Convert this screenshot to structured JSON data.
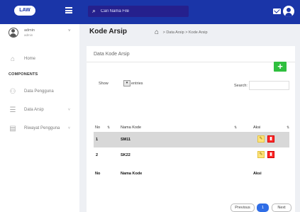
{
  "app": {
    "logo_text": "LAW"
  },
  "topbar": {
    "search_placeholder": "Cari Nama File"
  },
  "sidebar": {
    "user_name": "admin",
    "user_role": "admin",
    "section_label": "COMPONENTS",
    "items": [
      {
        "label": "Home",
        "icon": "home-icon"
      },
      {
        "label": "Data Pengguna",
        "icon": "users-icon"
      },
      {
        "label": "Data Arsip",
        "icon": "list-icon",
        "chevron": "˅"
      },
      {
        "label": "Riwayat Pengguna",
        "icon": "history-icon",
        "chevron": "˅"
      }
    ]
  },
  "page": {
    "title": "Kode Arsip",
    "breadcrumb": [
      "Data Arsip",
      "Kode Arsip"
    ],
    "breadcrumb_separator": ">"
  },
  "card": {
    "title": "Data Kode Arsip",
    "add_label": "+",
    "show_label": "Show",
    "entries_label": "entries",
    "search_label": "Search:",
    "columns": [
      "No",
      "Nama Kode",
      "Aksi"
    ],
    "rows": [
      {
        "no": "1",
        "nama_kode": "SM11"
      },
      {
        "no": "2",
        "nama_kode": "SK22"
      }
    ],
    "footer": [
      "No",
      "Nama Kode",
      "Aksi"
    ],
    "pagination": {
      "prev": "Previous",
      "current": "1",
      "next": "Next"
    }
  },
  "colors": {
    "topbar": "#1a35a8",
    "search_bg": "#25208d",
    "add_button": "#2fbf3e",
    "edit_button": "#ffe37a",
    "delete_button": "#ff2a2a",
    "active_page": "#2f6de6"
  }
}
